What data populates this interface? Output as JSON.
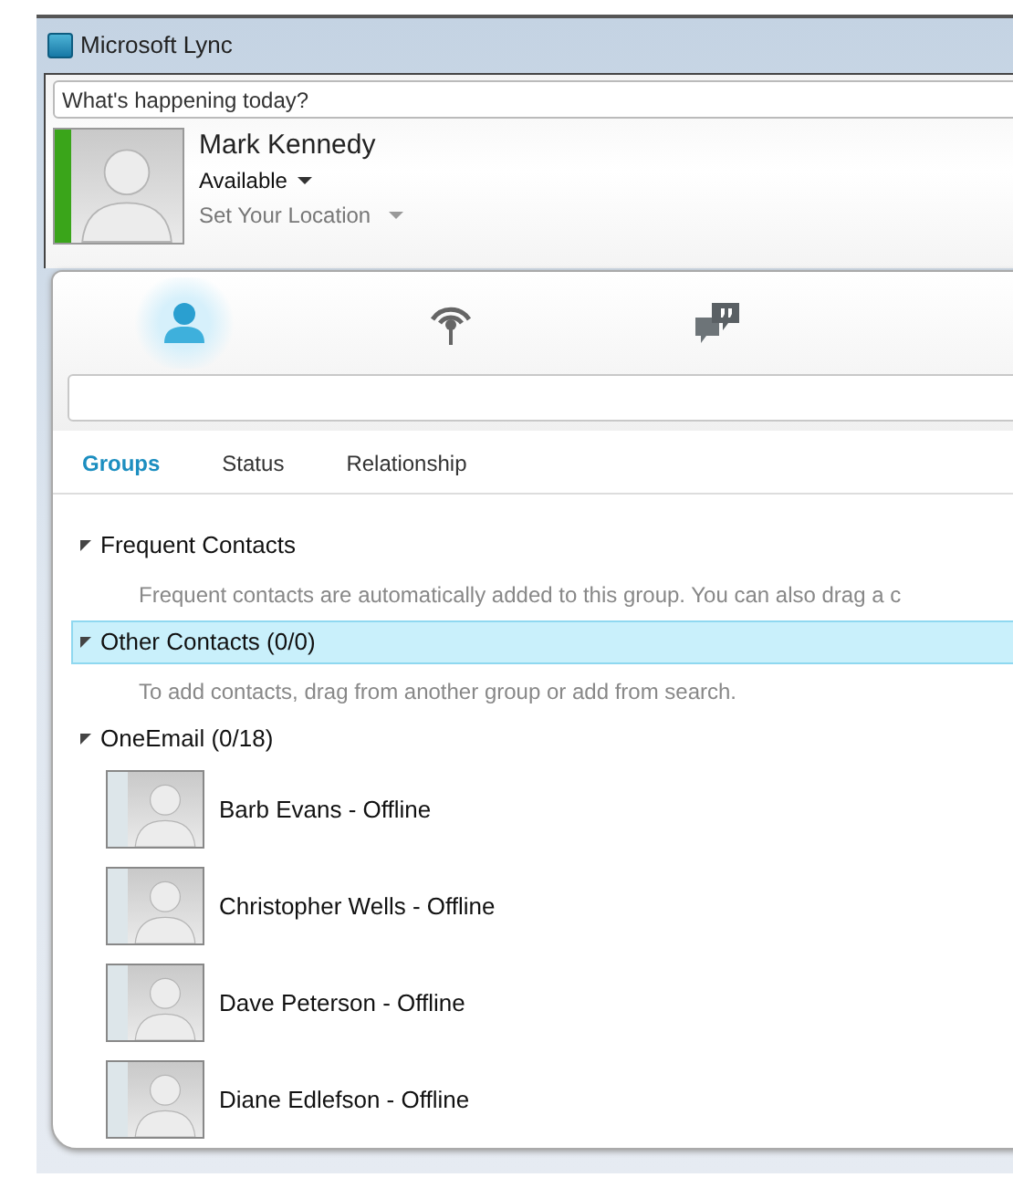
{
  "window": {
    "title": "Microsoft Lync"
  },
  "note": {
    "placeholder": "What's happening today?"
  },
  "profile": {
    "name": "Mark Kennedy",
    "status": "Available",
    "location": "Set Your Location",
    "color": "#3aa51a"
  },
  "views": [
    {
      "kind": "contacts",
      "selected": true
    },
    {
      "kind": "activity",
      "selected": false
    },
    {
      "kind": "conversations",
      "selected": false
    }
  ],
  "tabs": [
    {
      "label": "Groups",
      "selected": true
    },
    {
      "label": "Status",
      "selected": false
    },
    {
      "label": "Relationship",
      "selected": false
    }
  ],
  "groups": [
    {
      "name": "Frequent Contacts",
      "expanded": true,
      "selected": false,
      "hint": "Frequent contacts are automatically added to this group.  You can also drag a c"
    },
    {
      "name": "Other  Contacts (0/0)",
      "expanded": true,
      "selected": true,
      "hint": "To add contacts, drag from another group or add from search."
    },
    {
      "name": "OneEmail (0/18)",
      "expanded": true,
      "selected": false,
      "contacts": [
        {
          "label": "Barb Evans - Offline",
          "color": "#dde6ea"
        },
        {
          "label": "Christopher Wells - Offline",
          "color": "#dde6ea"
        },
        {
          "label": "Dave Peterson - Offline",
          "color": "#dde6ea"
        },
        {
          "label": "Diane Edlefson - Offline",
          "color": "#dde6ea"
        }
      ]
    }
  ]
}
